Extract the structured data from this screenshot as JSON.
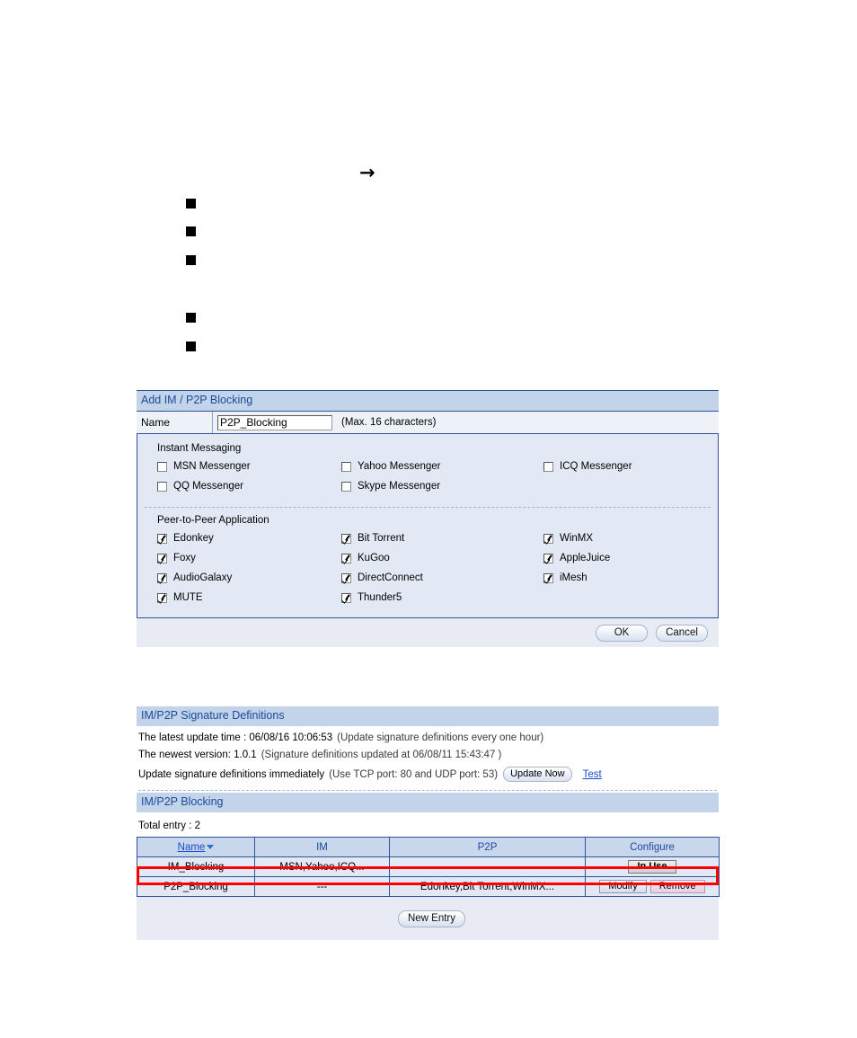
{
  "document_markers": {
    "arrow_glyph": "→",
    "bullet_glyph": "■",
    "bullet_count": 5
  },
  "add_form": {
    "title": "Add IM / P2P Blocking",
    "name_label": "Name",
    "name_value": "P2P_Blocking",
    "name_placeholder": "",
    "name_hint": "(Max. 16 characters)",
    "im_group_title": "Instant Messaging",
    "p2p_group_title": "Peer-to-Peer Application",
    "im_items": [
      {
        "label": "MSN Messenger",
        "checked": false
      },
      {
        "label": "Yahoo Messenger",
        "checked": false
      },
      {
        "label": "ICQ Messenger",
        "checked": false
      },
      {
        "label": "QQ Messenger",
        "checked": false
      },
      {
        "label": "Skype Messenger",
        "checked": false
      }
    ],
    "p2p_items": [
      {
        "label": "Edonkey",
        "checked": true
      },
      {
        "label": "Bit Torrent",
        "checked": true
      },
      {
        "label": "WinMX",
        "checked": true
      },
      {
        "label": "Foxy",
        "checked": true
      },
      {
        "label": "KuGoo",
        "checked": true
      },
      {
        "label": "AppleJuice",
        "checked": true
      },
      {
        "label": "AudioGalaxy",
        "checked": true
      },
      {
        "label": "DirectConnect",
        "checked": true
      },
      {
        "label": "iMesh",
        "checked": true
      },
      {
        "label": "MUTE",
        "checked": true
      },
      {
        "label": "Thunder5",
        "checked": true
      }
    ],
    "ok_label": "OK",
    "cancel_label": "Cancel"
  },
  "signature_panel": {
    "title": "IM/P2P Signature Definitions",
    "latest_update_label": "The latest update time : 06/08/16 10:06:53",
    "latest_update_note": "(Update signature definitions every one hour)",
    "newest_version_label": "The newest version: 1.0.1",
    "newest_version_note": "(Signature definitions updated at 06/08/11 15:43:47 )",
    "update_now_label": "Update signature definitions immediately",
    "update_now_note": "(Use TCP port: 80 and UDP port: 53)",
    "update_now_button": "Update Now",
    "test_link": "Test"
  },
  "blocking_panel": {
    "title": "IM/P2P Blocking",
    "total_entry": "Total entry : 2",
    "columns": [
      "Name",
      "IM",
      "P2P",
      "Configure"
    ],
    "rows": [
      {
        "name": "IM_Blocking",
        "im": "MSN,Yahoo,ICQ...",
        "p2p": "---",
        "buttons": [
          {
            "label": "In Use",
            "kind": "inuse"
          }
        ],
        "highlighted": false
      },
      {
        "name": "P2P_Blocking",
        "im": "---",
        "p2p": "Edonkey,Bit Torrent,WinMX...",
        "buttons": [
          {
            "label": "Modify",
            "kind": "modify"
          },
          {
            "label": "Remove",
            "kind": "remove"
          }
        ],
        "highlighted": true
      }
    ],
    "new_entry_label": "New Entry"
  },
  "colors": {
    "panel_header_bg": "#c3d3ea",
    "panel_header_text": "#1b4b9c",
    "form_body_bg": "#e2e9f4",
    "border_blue": "#2f5597",
    "link_blue": "#1b4bd0",
    "highlight_red": "#ff0000"
  }
}
